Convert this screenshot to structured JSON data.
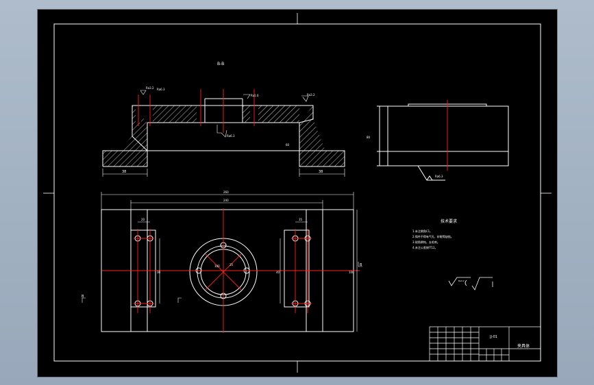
{
  "drawing": {
    "section_label": "B-B",
    "notes_title": "技术要求",
    "notes": [
      "1.未注倒角C1。",
      "2.铸件不得有气孔、砂眼等缺陷。",
      "3.锐角倒钝，去毛刺。",
      "4.未注公差按IT12。"
    ],
    "roughness_labels": [
      "Ra3.2",
      "Ra6.3",
      "Ra1.6",
      "Ra3.2",
      "Ra6.3",
      "Ra6.3",
      "Ra3.2"
    ],
    "dimension_labels": [
      "38",
      "38",
      "60",
      "260",
      "240",
      "20",
      "35",
      "30",
      "40",
      "100",
      "100",
      "25",
      "80"
    ],
    "title_block": {
      "drawing_name": "夹具体",
      "code": "JJ-01"
    },
    "view_marker": "B"
  },
  "colors": {
    "lines": "#ffffff",
    "center_lines": "#ff0000",
    "hatch": "#ffffff",
    "background": "#000000"
  }
}
